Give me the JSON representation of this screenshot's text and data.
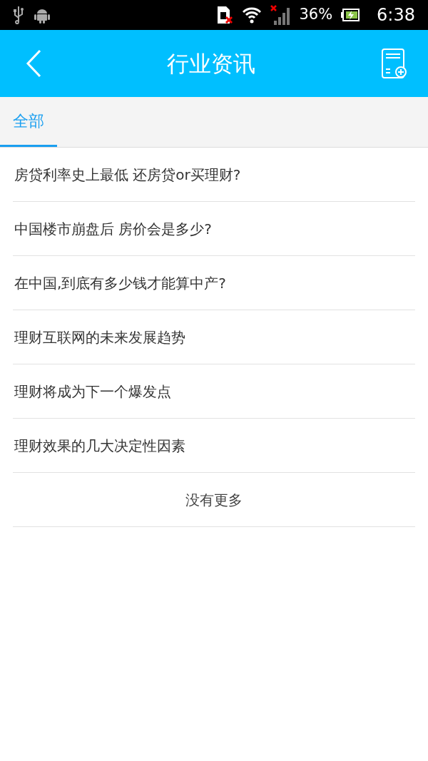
{
  "status_bar": {
    "battery": "36%",
    "time": "6:38"
  },
  "header": {
    "title": "行业资讯"
  },
  "tabs": [
    {
      "label": "全部",
      "selected": true
    }
  ],
  "articles": [
    {
      "title": "房贷利率史上最低 还房贷or买理财?"
    },
    {
      "title": "中国楼市崩盘后 房价会是多少?"
    },
    {
      "title": "在中国,到底有多少钱才能算中产?"
    },
    {
      "title": "理财互联网的未来发展趋势"
    },
    {
      "title": "理财将成为下一个爆发点"
    },
    {
      "title": "理财效果的几大决定性因素"
    }
  ],
  "footer": "没有更多"
}
